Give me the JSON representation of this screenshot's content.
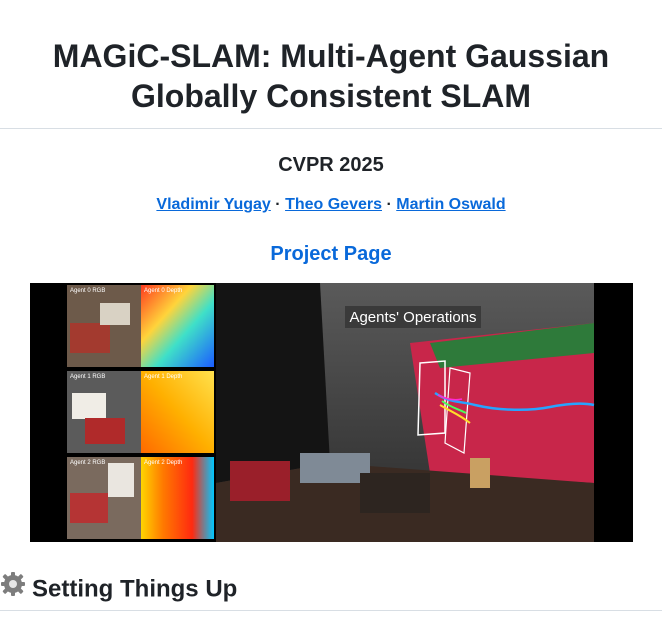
{
  "header": {
    "title": "MAGiC-SLAM: Multi-Agent Gaussian Globally Consistent SLAM"
  },
  "venue": "CVPR 2025",
  "authors": [
    "Vladimir Yugay",
    "Theo Gevers",
    "Martin Oswald"
  ],
  "author_separator": "·",
  "project_link": "Project Page",
  "teaser": {
    "caption": "Agents' Operations",
    "panels": [
      "Agent 0 RGB",
      "Agent 0 Depth",
      "Agent 1 RGB",
      "Agent 1 Depth",
      "Agent 2 RGB",
      "Agent 2 Depth"
    ]
  },
  "section": {
    "icon": "gear-icon",
    "heading": "Setting Things Up"
  }
}
